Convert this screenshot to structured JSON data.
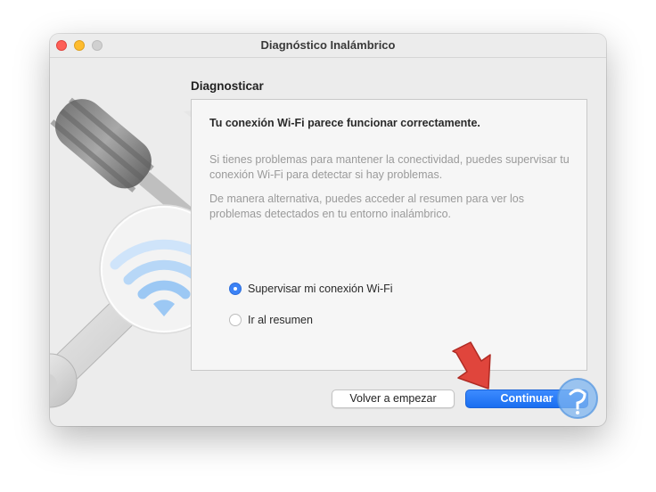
{
  "window": {
    "title": "Diagnóstico Inalámbrico"
  },
  "section": {
    "heading": "Diagnosticar"
  },
  "panel": {
    "status": "Tu conexión Wi-Fi parece funcionar correctamente.",
    "paragraph1": "Si tienes problemas para mantener la conectividad, puedes supervisar tu conexión Wi-Fi para detectar si hay problemas.",
    "paragraph2": "De manera alternativa, puedes acceder al resumen para ver los problemas detectados en tu entorno inalámbrico.",
    "options": [
      {
        "label": "Supervisar mi conexión Wi-Fi",
        "selected": true
      },
      {
        "label": "Ir al resumen",
        "selected": false
      }
    ]
  },
  "buttons": {
    "back": "Volver a empezar",
    "continue": "Continuar"
  },
  "colors": {
    "accent": "#1a6ef0",
    "annotation_arrow": "#e0453c",
    "wifi": "#9cc8f4"
  }
}
